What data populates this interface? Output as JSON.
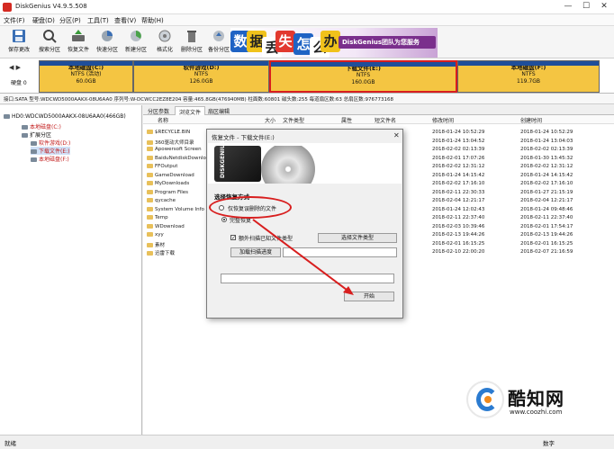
{
  "window": {
    "title": "DiskGenius V4.9.5.508",
    "controls": [
      "—",
      "☐",
      "✕"
    ]
  },
  "menu": [
    "文件(F)",
    "硬盘(D)",
    "分区(P)",
    "工具(T)",
    "查看(V)",
    "帮助(H)"
  ],
  "toolbar": [
    {
      "label": "保存更改",
      "icon": "save-icon"
    },
    {
      "label": "搜索分区",
      "icon": "search-icon"
    },
    {
      "label": "恢复文件",
      "icon": "recover-icon"
    },
    {
      "label": "快速分区",
      "icon": "quick-partition-icon"
    },
    {
      "label": "新建分区",
      "icon": "new-partition-icon"
    },
    {
      "label": "格式化",
      "icon": "format-icon"
    },
    {
      "label": "删除分区",
      "icon": "delete-icon"
    },
    {
      "label": "备份分区",
      "icon": "backup-icon"
    }
  ],
  "banner": {
    "chars": [
      "数",
      "据",
      "丢",
      "失",
      "怎",
      "么",
      "办"
    ],
    "brand": "DiskGenius团队为您服务"
  },
  "diskmap": {
    "nav": "◀ ▶",
    "disk_label": "硬盘 0",
    "partitions": [
      {
        "name": "本地磁盘(C:)",
        "fs": "NTFS (活动)",
        "size": "60.0GB",
        "color": "#1f4e9a"
      },
      {
        "name": "软件游戏(D:)",
        "fs": "NTFS",
        "size": "126.0GB",
        "color": "#1f4e9a"
      },
      {
        "name": "下载文件(E:)",
        "fs": "NTFS",
        "size": "160.0GB",
        "color": "#1f4e9a"
      },
      {
        "name": "本地磁盘(F:)",
        "fs": "NTFS",
        "size": "119.7GB",
        "color": "#1f4e9a"
      }
    ]
  },
  "diskinfo": "接口:SATA   型号:WDCWD5000AAKX-08U6AA0   序列号:W-DCWCC2EZ8E204   容量:465.8GB(476940MB)   柱面数:60801   磁头数:255   每道扇区数:63   总扇区数:976773168",
  "tree": {
    "root": "HD0:WDCWD5000AAKX-08U6AA0(466GB)",
    "items": [
      {
        "label": "本地磁盘(C:)",
        "level": 1,
        "color": "#c21b1b"
      },
      {
        "label": "扩展分区",
        "level": 1,
        "color": "#111"
      },
      {
        "label": "软件游戏(D:)",
        "level": 2,
        "color": "#c21b1b"
      },
      {
        "label": "下载文件(E:)",
        "level": 2,
        "color": "#c21b1b"
      },
      {
        "label": "本地磁盘(F:)",
        "level": 2,
        "color": "#c21b1b"
      }
    ]
  },
  "tabs": [
    "分区参数",
    "浏览文件",
    "扇区编辑"
  ],
  "columns": [
    "名称",
    "大小",
    "文件类型",
    "属性",
    "短文件名",
    "修改时间",
    "创建时间"
  ],
  "files": [
    {
      "name": "$RECYCLE.BIN",
      "mtime": "2018-01-24 10:52:29",
      "ctime": "2018-01-24 10:52:29"
    },
    {
      "name": "360驱动大师目录",
      "mtime": "2018-01-24 13:04:52",
      "ctime": "2018-01-24 13:04:03"
    },
    {
      "name": "Apowersoft Screen",
      "mtime": "2018-02-02 02:13:39",
      "ctime": "2018-02-02 02:13:39"
    },
    {
      "name": "BaiduNetdiskDownlo",
      "mtime": "2018-02-01 17:07:26",
      "ctime": "2018-01-30 13:45:32"
    },
    {
      "name": "FFOutput",
      "mtime": "2018-02-02 12:31:12",
      "ctime": "2018-02-02 12:31:12"
    },
    {
      "name": "GameDownload",
      "mtime": "2018-01-24 14:15:42",
      "ctime": "2018-01-24 14:15:42"
    },
    {
      "name": "MyDownloads",
      "mtime": "2018-02-02 17:16:10",
      "ctime": "2018-02-02 17:16:10"
    },
    {
      "name": "Program Files",
      "mtime": "2018-02-11 22:30:33",
      "ctime": "2018-01-27 21:15:19"
    },
    {
      "name": "qycache",
      "mtime": "2018-02-04 12:21:17",
      "ctime": "2018-02-04 12:21:17"
    },
    {
      "name": "System Volume Info",
      "mtime": "2018-01-24 12:02:43",
      "ctime": "2018-01-24 09:48:46"
    },
    {
      "name": "Temp",
      "mtime": "2018-02-11 22:37:40",
      "ctime": "2018-02-11 22:37:40"
    },
    {
      "name": "WDownload",
      "mtime": "2018-02-03 10:39:46",
      "ctime": "2018-02-01 17:54:17"
    },
    {
      "name": "xyy",
      "mtime": "2018-02-13 19:44:26",
      "ctime": "2018-02-13 19:44:26"
    },
    {
      "name": "素材",
      "mtime": "2018-02-01 16:15:25",
      "ctime": "2018-02-01 16:15:25"
    },
    {
      "name": "迅雷下载",
      "mtime": "2018-02-10 22:00:20",
      "ctime": "2018-02-07 21:16:59"
    }
  ],
  "dialog": {
    "title": "恢复文件 - 下载文件(E:)",
    "close": "✕",
    "hdd_brand": "DISKGENIUS",
    "section": "选择恢复方式",
    "opt_deleted": "仅恢复误删除的文件",
    "opt_full": "完整恢复",
    "chk_extra": "额外扫描已知文件类型",
    "btn_select_types": "选择文件类型",
    "btn_load_progress": "加载扫描进度",
    "btn_start": "开始"
  },
  "status": {
    "left": "就绪",
    "right": "数字"
  },
  "watermark": {
    "name": "酷知网",
    "url": "www.coozhi.com"
  },
  "colors": {
    "accent_red": "#d81e1e",
    "disk_blue": "#1f4e9a",
    "active_partition_border": "#d81e1e"
  }
}
